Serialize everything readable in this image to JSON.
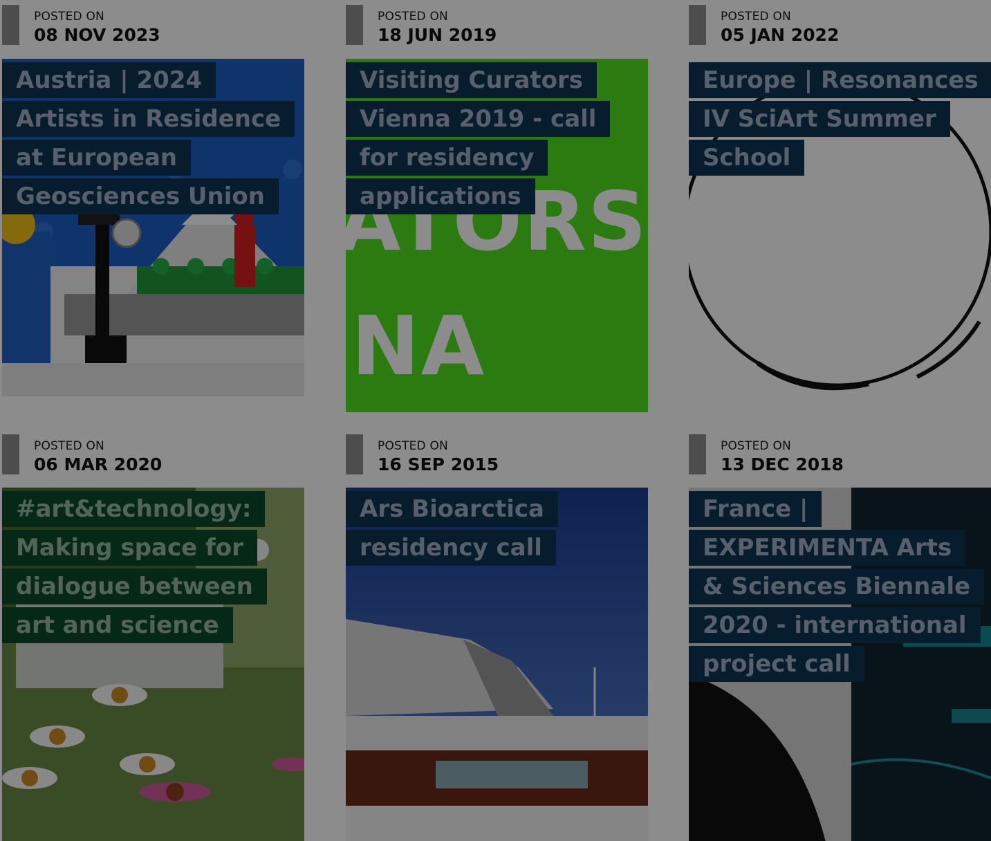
{
  "cards": [
    {
      "posted_label": "POSTED ON",
      "date": "08 NOV 2023",
      "title": "Austria | 2024 Artists in Residence at European Geosciences Union"
    },
    {
      "posted_label": "POSTED ON",
      "date": "18 JUN 2019",
      "title": "Visiting Curators Vienna 2019 - call for residency applications",
      "image_text": {
        "line1": "ATORS",
        "line2": "NA"
      }
    },
    {
      "posted_label": "POSTED ON",
      "date": "05 JAN 2022",
      "title": "Europe | Resonances IV SciArt Summer School"
    },
    {
      "posted_label": "POSTED ON",
      "date": "06 MAR 2020",
      "title": "#art&technology: Making space for dialogue between art and science"
    },
    {
      "posted_label": "POSTED ON",
      "date": "16 SEP 2015",
      "title": "Ars Bioarctica residency call"
    },
    {
      "posted_label": "POSTED ON",
      "date": "13 DEC 2018",
      "title": "France | EXPERIMENTA Arts & Sciences Biennale 2020 - international project call"
    }
  ],
  "colors": {
    "title_bg": "#0d3552",
    "title_bg_green": "#0c4a2a",
    "title_text": "#9eb0c4",
    "date_bar": "#8c8c8c",
    "modal_overlay": "rgba(0,0,0,0.45)"
  }
}
